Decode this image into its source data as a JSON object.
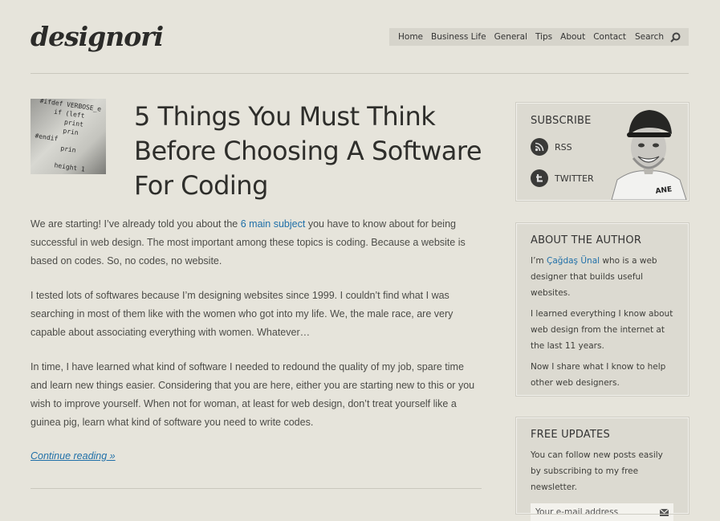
{
  "header": {
    "logo": "designori",
    "nav": [
      "Home",
      "Business Life",
      "General",
      "Tips",
      "About",
      "Contact"
    ],
    "search_label": "Search"
  },
  "post": {
    "title": "5 Things You Must Think Before Choosing A Software For Coding",
    "p1_before": "We are starting! I’ve already told you about the ",
    "p1_link": "6 main subject",
    "p1_after": " you have to know about for being successful in web design. The most important among these topics is coding. Because a website is based on codes. So, no codes, no website.",
    "p2": "I tested lots of softwares because I’m designing websites since 1999. I couldn’t find what I was searching in most of them like with the women who got into my life. We, the male race, are very capable about associating everything with women. Whatever…",
    "p3": "In time, I have learned what kind of software I needed to redound the quality of my job, spare time and learn new things easier. Considering that you are here, either you are starting new to this or you wish to improve yourself. When not for woman, at least for web design, don’t treat yourself like a guinea pig, learn what kind of software you need to write codes.",
    "continue": "Continue reading »"
  },
  "sidebar": {
    "subscribe": {
      "title": "SUBSCRIBE",
      "rss": "RSS",
      "twitter": "TWITTER"
    },
    "author": {
      "title": "ABOUT THE AUTHOR",
      "p1_before": "I’m ",
      "p1_link": "Çağdaş Ünal",
      "p1_after": " who is a web designer that builds useful websites.",
      "p2": "I learned everything I know about web design from the internet at the last 11 years.",
      "p3": "Now I share what I know to help other web designers."
    },
    "updates": {
      "title": "FREE UPDATES",
      "text": "You can follow new posts easily by subscribing to my free newsletter.",
      "placeholder": "Your e-mail address"
    }
  },
  "colors": {
    "link": "#1f6fa8",
    "background": "#e6e4db"
  }
}
